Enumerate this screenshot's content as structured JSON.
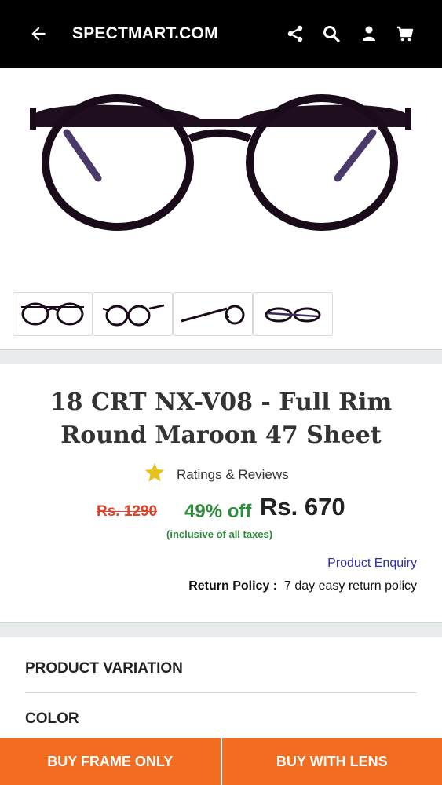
{
  "header": {
    "brand": "SPECTMART.COM",
    "icons": [
      "back-arrow-icon",
      "share-icon",
      "search-icon",
      "user-icon",
      "cart-icon"
    ]
  },
  "product": {
    "title_line1": "18 CRT NX-V08 - Full Rim",
    "title_line2": "Round Maroon 47 Sheet",
    "ratings_label": "Ratings & Reviews",
    "mrp": "Rs. 1290",
    "discount": "49% off",
    "price": "Rs. 670",
    "taxes_note": "(inclusive of all taxes)",
    "enquiry_label": "Product Enquiry",
    "return_label": "Return Policy :",
    "return_value": "7 day easy return policy"
  },
  "sections": {
    "variation_title": "PRODUCT VARIATION",
    "color_title": "COLOR"
  },
  "footer": {
    "buy_frame_label": "BUY FRAME ONLY",
    "buy_lens_label": "BUY WITH LENS"
  },
  "colors": {
    "header_bg": "#000000",
    "accent_orange": "#f36c1f",
    "discount_green": "#2e8b3c",
    "mrp_red": "#e2402a",
    "link_blue": "#2d2da8"
  }
}
